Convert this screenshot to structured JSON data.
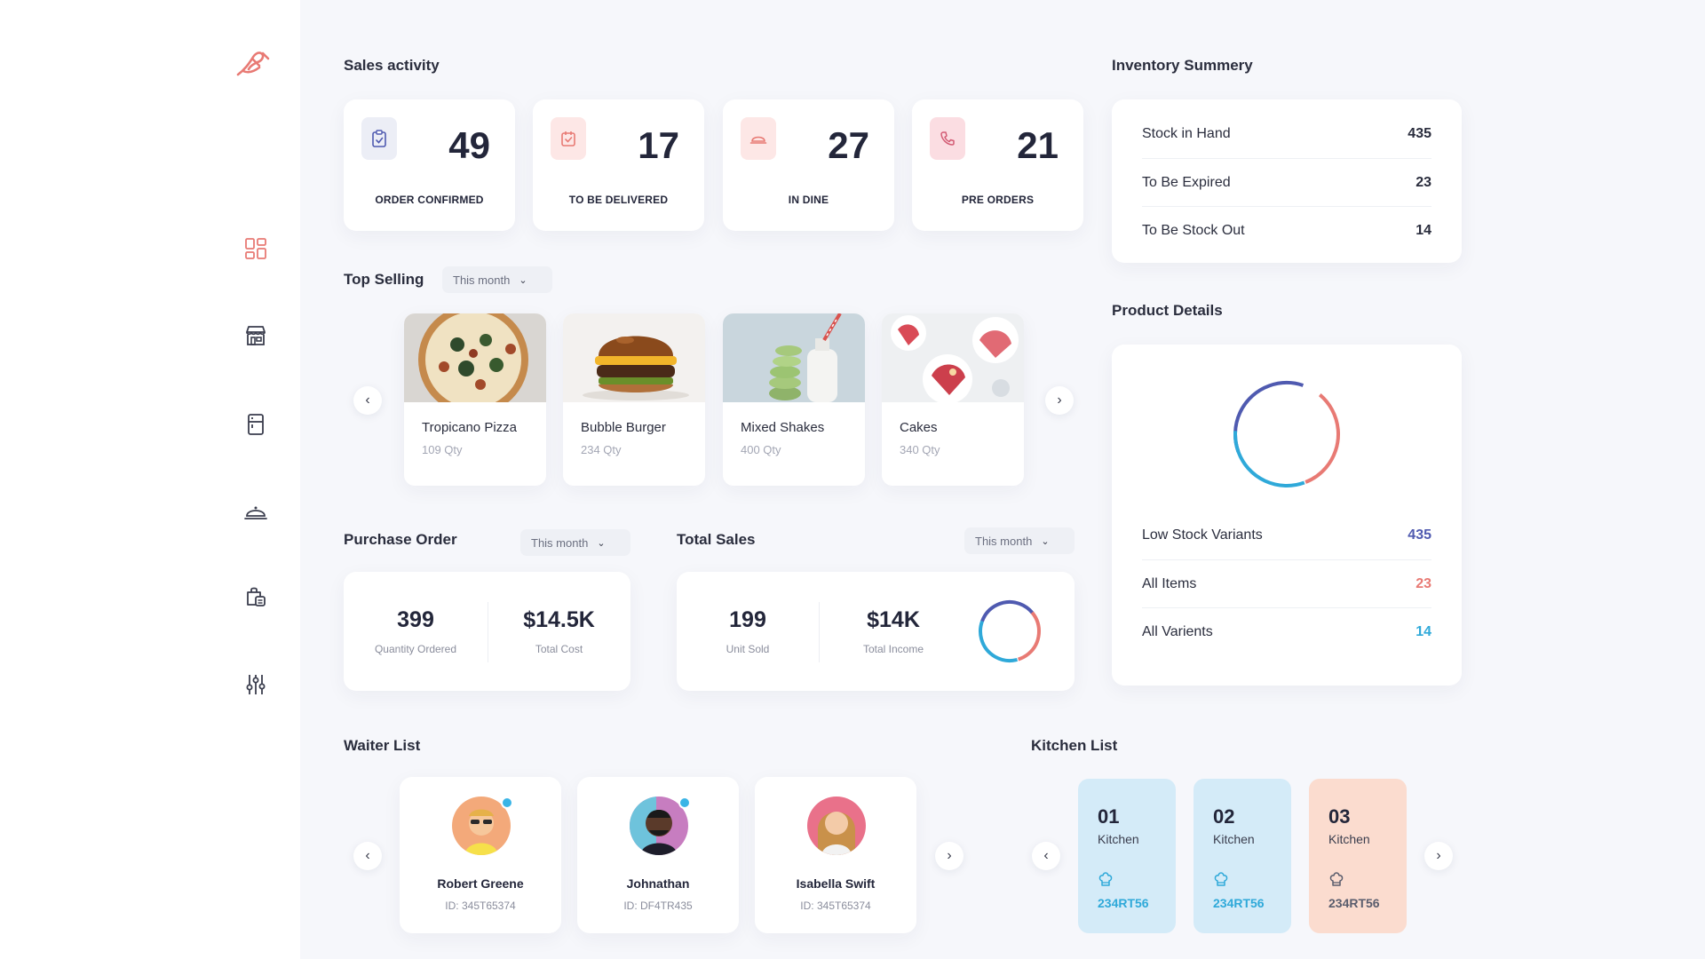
{
  "colors": {
    "accent": "#e87a74",
    "blue": "#4f5ab0",
    "cyan": "#2fa9d9",
    "kitchen_blue": "#d4ebf8",
    "kitchen_peach": "#fbdccf"
  },
  "sidebar": {
    "logo_icon": "chef-logo",
    "items": [
      {
        "icon": "dashboard-grid-icon"
      },
      {
        "icon": "storefront-icon"
      },
      {
        "icon": "fridge-icon"
      },
      {
        "icon": "food-cloche-icon"
      },
      {
        "icon": "order-bag-icon"
      },
      {
        "icon": "sliders-icon"
      }
    ]
  },
  "sales_activity": {
    "title": "Sales activity",
    "cards": [
      {
        "value": "49",
        "label": "ORDER CONFIRMED",
        "icon": "clipboard-check-icon"
      },
      {
        "value": "17",
        "label": "TO BE DELIVERED",
        "icon": "calendar-check-icon"
      },
      {
        "value": "27",
        "label": "IN DINE",
        "icon": "dine-cloche-icon"
      },
      {
        "value": "21",
        "label": "PRE ORDERS",
        "icon": "phone-icon"
      }
    ]
  },
  "top_selling": {
    "title": "Top Selling",
    "filter": "This month",
    "items": [
      {
        "name": "Tropicano Pizza",
        "qty": "109 Qty"
      },
      {
        "name": "Bubble Burger",
        "qty": "234 Qty"
      },
      {
        "name": "Mixed Shakes",
        "qty": "400 Qty"
      },
      {
        "name": "Cakes",
        "qty": "340 Qty"
      }
    ]
  },
  "purchase_order": {
    "title": "Purchase Order",
    "filter": "This month",
    "metrics": [
      {
        "value": "399",
        "label": "Quantity Ordered"
      },
      {
        "value": "$14.5K",
        "label": "Total Cost"
      }
    ]
  },
  "total_sales": {
    "title": "Total Sales",
    "filter": "This month",
    "metrics": [
      {
        "value": "199",
        "label": "Unit Sold"
      },
      {
        "value": "$14K",
        "label": "Total Income"
      }
    ]
  },
  "inventory": {
    "title": "Inventory Summery",
    "rows": [
      {
        "label": "Stock in Hand",
        "value": "435"
      },
      {
        "label": "To Be Expired",
        "value": "23"
      },
      {
        "label": "To Be Stock Out",
        "value": "14"
      }
    ]
  },
  "product_details": {
    "title": "Product Details",
    "rows": [
      {
        "label": "Low Stock Variants",
        "value": "435"
      },
      {
        "label": "All Items",
        "value": "23"
      },
      {
        "label": "All Varients",
        "value": "14"
      }
    ]
  },
  "waiter_list": {
    "title": "Waiter List",
    "waiters": [
      {
        "name": "Robert Greene",
        "id": "ID: 345T65374"
      },
      {
        "name": "Johnathan",
        "id": "ID: DF4TR435"
      },
      {
        "name": "Isabella Swift",
        "id": "ID: 345T65374"
      }
    ]
  },
  "kitchen_list": {
    "title": "Kitchen List",
    "kitchens": [
      {
        "number": "01",
        "label": "Kitchen",
        "code": "234RT56"
      },
      {
        "number": "02",
        "label": "Kitchen",
        "code": "234RT56"
      },
      {
        "number": "03",
        "label": "Kitchen",
        "code": "234RT56"
      }
    ]
  }
}
